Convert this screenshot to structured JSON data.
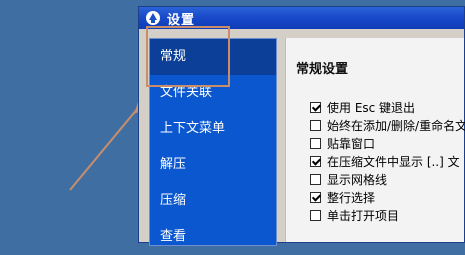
{
  "window": {
    "title": "设置"
  },
  "sidebar": {
    "items": [
      {
        "label": "常规",
        "selected": true
      },
      {
        "label": "文件关联",
        "selected": false
      },
      {
        "label": "上下文菜单",
        "selected": false
      },
      {
        "label": "解压",
        "selected": false
      },
      {
        "label": "压缩",
        "selected": false
      },
      {
        "label": "查看",
        "selected": false
      }
    ]
  },
  "general": {
    "section_title": "常规设置",
    "options": [
      {
        "label": "使用 Esc 键退出",
        "checked": true
      },
      {
        "label": "始终在添加/删除/重命名文",
        "checked": false
      },
      {
        "label": "贴靠窗口",
        "checked": false
      },
      {
        "label": "在压缩文件中显示 [..] 文",
        "checked": true
      },
      {
        "label": "显示网格线",
        "checked": false
      },
      {
        "label": "整行选择",
        "checked": true
      },
      {
        "label": "单击打开项目",
        "checked": false
      }
    ]
  },
  "annotation": {
    "color": "#c98d6b"
  },
  "colors": {
    "desktop": "#3f6fa2",
    "sidebar_bg": "#0a57cf",
    "sidebar_selected": "#0c3f97",
    "titlebar": "#1848c8"
  },
  "icons": {
    "app": "app-logo-icon"
  }
}
